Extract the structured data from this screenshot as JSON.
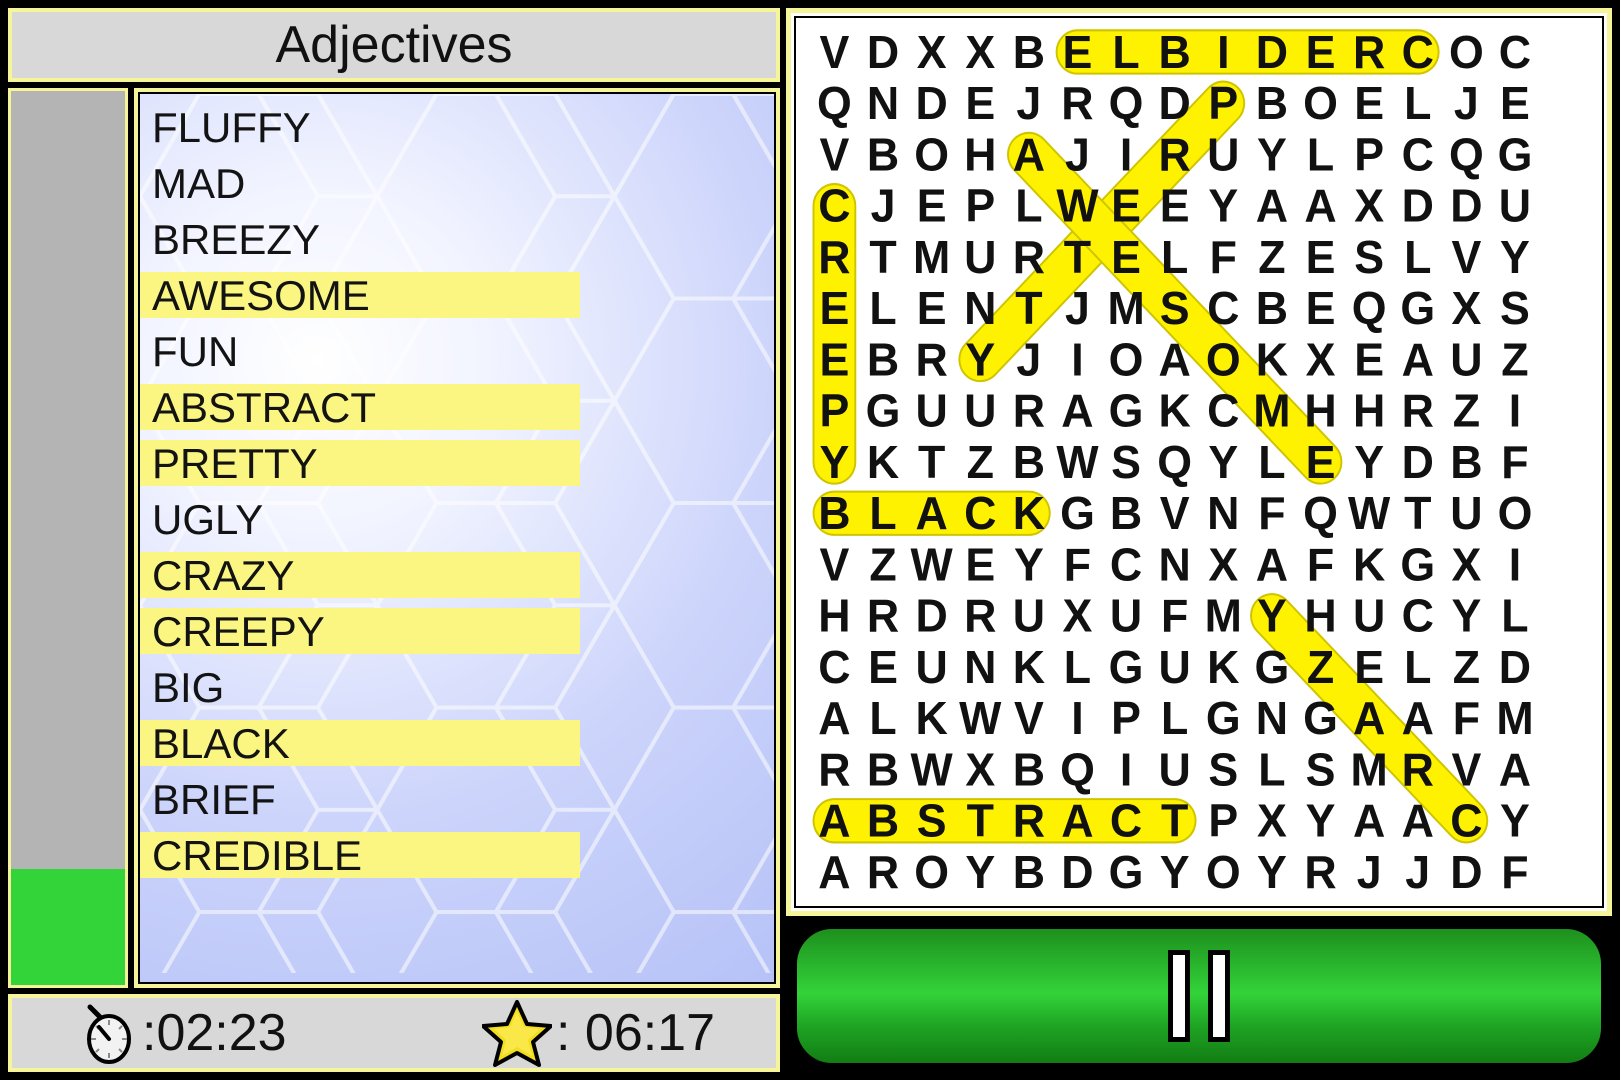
{
  "header": {
    "title": "Adjectives"
  },
  "progress": {
    "percent": 13,
    "track_color": "#b4b4b4",
    "fill_color": "#33d33a"
  },
  "wordlist": {
    "items": [
      {
        "word": "FLUFFY",
        "found": false
      },
      {
        "word": "MAD",
        "found": false
      },
      {
        "word": "BREEZY",
        "found": false
      },
      {
        "word": "AWESOME",
        "found": true
      },
      {
        "word": "FUN",
        "found": false
      },
      {
        "word": "ABSTRACT",
        "found": true
      },
      {
        "word": "PRETTY",
        "found": true
      },
      {
        "word": "UGLY",
        "found": false
      },
      {
        "word": "CRAZY",
        "found": true
      },
      {
        "word": "CREEPY",
        "found": true
      },
      {
        "word": "BIG",
        "found": false
      },
      {
        "word": "BLACK",
        "found": true
      },
      {
        "word": "BRIEF",
        "found": false
      },
      {
        "word": "CREDIBLE",
        "found": true
      }
    ],
    "found_highlight_color": "#fbf682"
  },
  "status": {
    "timer_icon": "stopwatch-icon",
    "timer_value": ":02:23",
    "bonus_icon": "star-icon",
    "bonus_value": ": 06:17"
  },
  "controls": {
    "pause_label": "pause-button",
    "pause_icon": "pause-icon",
    "pause_color": "#33d33a"
  },
  "grid": {
    "rows": 17,
    "cols": 16,
    "letters": [
      [
        "V",
        "D",
        "X",
        "X",
        "B",
        "E",
        "L",
        "B",
        "I",
        "D",
        "E",
        "R",
        "C",
        "O",
        "C",
        ""
      ],
      [
        "Q",
        "N",
        "D",
        "E",
        "J",
        "R",
        "Q",
        "D",
        "P",
        "B",
        "O",
        "E",
        "L",
        "J",
        "E",
        ""
      ],
      [
        "V",
        "B",
        "O",
        "H",
        "A",
        "J",
        "I",
        "R",
        "U",
        "Y",
        "L",
        "P",
        "C",
        "Q",
        "G",
        ""
      ],
      [
        "C",
        "J",
        "E",
        "P",
        "L",
        "W",
        "E",
        "E",
        "Y",
        "A",
        "A",
        "X",
        "D",
        "D",
        "U",
        ""
      ],
      [
        "R",
        "T",
        "M",
        "U",
        "R",
        "T",
        "E",
        "L",
        "F",
        "Z",
        "E",
        "S",
        "L",
        "V",
        "Y",
        ""
      ],
      [
        "E",
        "L",
        "E",
        "N",
        "T",
        "J",
        "M",
        "S",
        "C",
        "B",
        "E",
        "Q",
        "G",
        "X",
        "S",
        ""
      ],
      [
        "E",
        "B",
        "R",
        "Y",
        "J",
        "I",
        "O",
        "A",
        "O",
        "K",
        "X",
        "E",
        "A",
        "U",
        "Z",
        ""
      ],
      [
        "P",
        "G",
        "U",
        "U",
        "R",
        "A",
        "G",
        "K",
        "C",
        "M",
        "H",
        "H",
        "R",
        "Z",
        "I",
        ""
      ],
      [
        "Y",
        "K",
        "T",
        "Z",
        "B",
        "W",
        "S",
        "Q",
        "Y",
        "L",
        "E",
        "Y",
        "D",
        "B",
        "F",
        ""
      ],
      [
        "B",
        "L",
        "A",
        "C",
        "K",
        "G",
        "B",
        "V",
        "N",
        "F",
        "Q",
        "W",
        "T",
        "U",
        "O",
        ""
      ],
      [
        "V",
        "Z",
        "W",
        "E",
        "Y",
        "F",
        "C",
        "N",
        "X",
        "A",
        "F",
        "K",
        "G",
        "X",
        "I",
        ""
      ],
      [
        "H",
        "R",
        "D",
        "R",
        "U",
        "X",
        "U",
        "F",
        "M",
        "Y",
        "H",
        "U",
        "C",
        "Y",
        "L",
        ""
      ],
      [
        "C",
        "E",
        "U",
        "N",
        "K",
        "L",
        "G",
        "U",
        "K",
        "G",
        "Z",
        "E",
        "L",
        "Z",
        "D",
        ""
      ],
      [
        "A",
        "L",
        "K",
        "W",
        "V",
        "I",
        "P",
        "L",
        "G",
        "N",
        "G",
        "A",
        "A",
        "F",
        "M",
        ""
      ],
      [
        "R",
        "B",
        "W",
        "X",
        "B",
        "Q",
        "I",
        "U",
        "S",
        "L",
        "S",
        "M",
        "R",
        "V",
        "A",
        ""
      ],
      [
        "A",
        "B",
        "S",
        "T",
        "R",
        "A",
        "C",
        "T",
        "P",
        "X",
        "Y",
        "A",
        "A",
        "C",
        "Y",
        ""
      ],
      [
        "A",
        "R",
        "O",
        "Y",
        "B",
        "D",
        "G",
        "Y",
        "O",
        "Y",
        "R",
        "J",
        "J",
        "D",
        "F",
        ""
      ]
    ],
    "highlight_color": "#fff200",
    "highlight_stroke": "#cfc400",
    "found_words": [
      {
        "word": "CREDIBLE",
        "start": [
          0,
          12
        ],
        "end": [
          0,
          5
        ],
        "note": "row 1, reversed horizontal"
      },
      {
        "word": "PRETTY",
        "start": [
          1,
          8
        ],
        "end": [
          6,
          3
        ],
        "note": "diagonal down-left"
      },
      {
        "word": "AWESOME",
        "start": [
          2,
          4
        ],
        "end": [
          8,
          10
        ],
        "note": "diagonal down-right"
      },
      {
        "word": "CREEPY",
        "start": [
          3,
          0
        ],
        "end": [
          8,
          0
        ],
        "note": "vertical down, column 1"
      },
      {
        "word": "BLACK",
        "start": [
          9,
          0
        ],
        "end": [
          9,
          4
        ],
        "note": "row 10, horizontal"
      },
      {
        "word": "CRAZY",
        "start": [
          15,
          13
        ],
        "end": [
          11,
          9
        ],
        "note": "diagonal up-left, reversed"
      },
      {
        "word": "ABSTRACT",
        "start": [
          15,
          0
        ],
        "end": [
          15,
          7
        ],
        "note": "row 16, horizontal"
      }
    ]
  }
}
